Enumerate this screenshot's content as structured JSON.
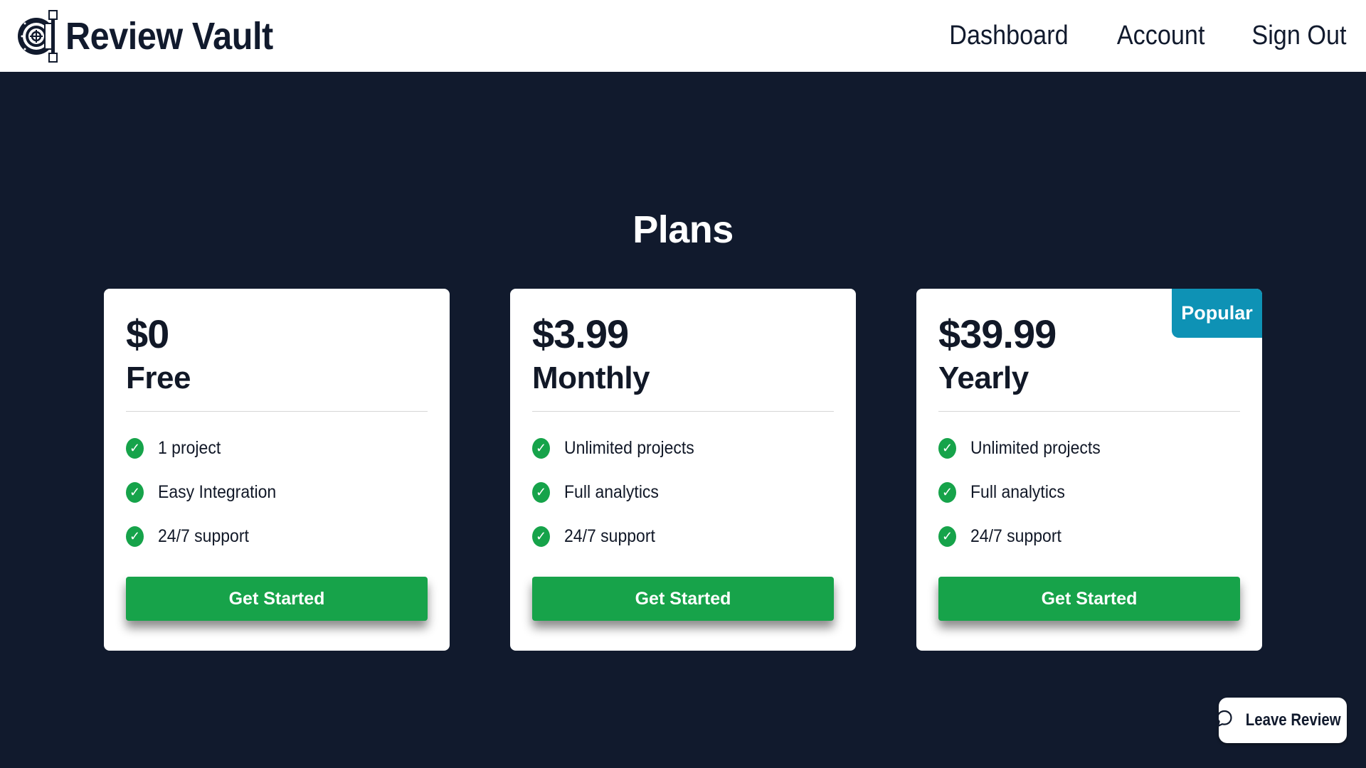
{
  "app": {
    "name": "Review Vault",
    "logo_icon": "vault-door-icon"
  },
  "nav": {
    "items": [
      {
        "label": "Dashboard"
      },
      {
        "label": "Account"
      },
      {
        "label": "Sign Out"
      }
    ]
  },
  "page": {
    "title": "Plans"
  },
  "plans": [
    {
      "price": "$0",
      "period": "Free",
      "features": [
        "1 project",
        "Easy Integration",
        "24/7 support"
      ],
      "cta_label": "Get Started",
      "badge": null
    },
    {
      "price": "$3.99",
      "period": "Monthly",
      "features": [
        "Unlimited projects",
        "Full analytics",
        "24/7 support"
      ],
      "cta_label": "Get Started",
      "badge": null
    },
    {
      "price": "$39.99",
      "period": "Yearly",
      "features": [
        "Unlimited projects",
        "Full analytics",
        "24/7 support"
      ],
      "cta_label": "Get Started",
      "badge": "Popular"
    }
  ],
  "feedback": {
    "label": "Leave Review",
    "icon": "chat-bubble-icon"
  },
  "colors": {
    "background": "#111a2d",
    "accent_green": "#17a34a",
    "badge_blue": "#0e92b5",
    "text_dark": "#111827"
  }
}
